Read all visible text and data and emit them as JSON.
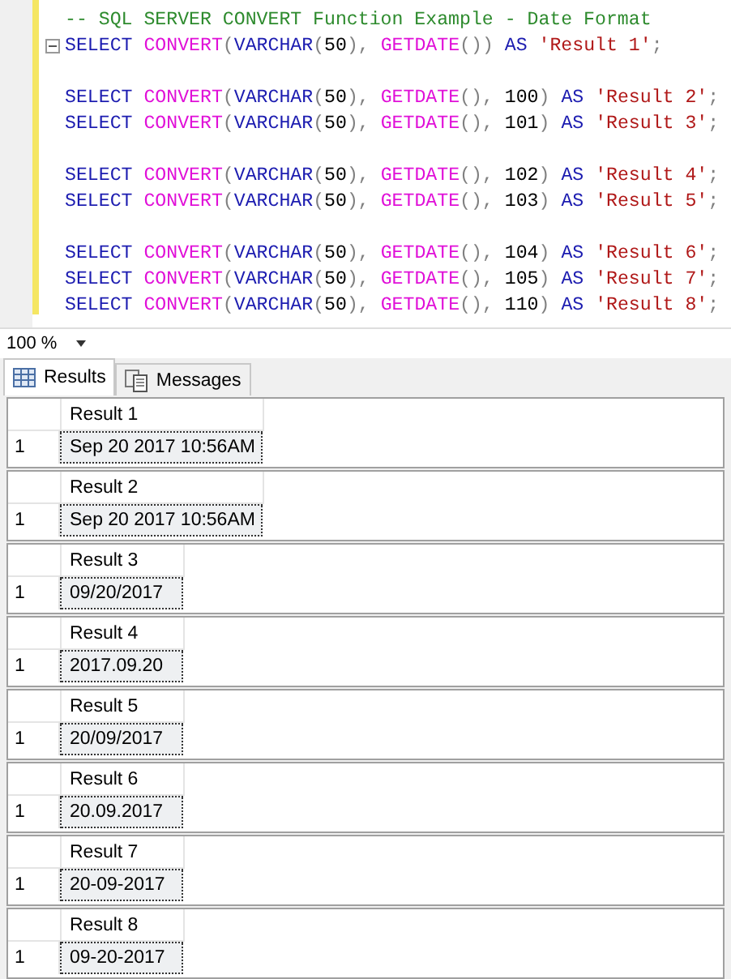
{
  "editor": {
    "blocks": [
      {
        "lines": [
          {
            "fold": false,
            "tokens": [
              {
                "kind": "comment",
                "text": "-- SQL SERVER CONVERT Function Example - Date Format"
              }
            ]
          },
          {
            "fold": true,
            "tokens": [
              {
                "kind": "keyword",
                "text": "SELECT "
              },
              {
                "kind": "function",
                "text": "CONVERT"
              },
              {
                "kind": "punct",
                "text": "("
              },
              {
                "kind": "keyword",
                "text": "VARCHAR"
              },
              {
                "kind": "punct",
                "text": "("
              },
              {
                "kind": "number",
                "text": "50"
              },
              {
                "kind": "punct",
                "text": "), "
              },
              {
                "kind": "function",
                "text": "GETDATE"
              },
              {
                "kind": "punct",
                "text": "()) "
              },
              {
                "kind": "keyword",
                "text": "AS "
              },
              {
                "kind": "string",
                "text": "'Result 1'"
              },
              {
                "kind": "punct",
                "text": ";"
              }
            ]
          }
        ]
      },
      {
        "lines": [
          {
            "fold": false,
            "tokens": [
              {
                "kind": "keyword",
                "text": "SELECT "
              },
              {
                "kind": "function",
                "text": "CONVERT"
              },
              {
                "kind": "punct",
                "text": "("
              },
              {
                "kind": "keyword",
                "text": "VARCHAR"
              },
              {
                "kind": "punct",
                "text": "("
              },
              {
                "kind": "number",
                "text": "50"
              },
              {
                "kind": "punct",
                "text": "), "
              },
              {
                "kind": "function",
                "text": "GETDATE"
              },
              {
                "kind": "punct",
                "text": "(), "
              },
              {
                "kind": "number",
                "text": "100"
              },
              {
                "kind": "punct",
                "text": ") "
              },
              {
                "kind": "keyword",
                "text": "AS "
              },
              {
                "kind": "string",
                "text": "'Result 2'"
              },
              {
                "kind": "punct",
                "text": ";"
              }
            ]
          },
          {
            "fold": false,
            "tokens": [
              {
                "kind": "keyword",
                "text": "SELECT "
              },
              {
                "kind": "function",
                "text": "CONVERT"
              },
              {
                "kind": "punct",
                "text": "("
              },
              {
                "kind": "keyword",
                "text": "VARCHAR"
              },
              {
                "kind": "punct",
                "text": "("
              },
              {
                "kind": "number",
                "text": "50"
              },
              {
                "kind": "punct",
                "text": "), "
              },
              {
                "kind": "function",
                "text": "GETDATE"
              },
              {
                "kind": "punct",
                "text": "(), "
              },
              {
                "kind": "number",
                "text": "101"
              },
              {
                "kind": "punct",
                "text": ") "
              },
              {
                "kind": "keyword",
                "text": "AS "
              },
              {
                "kind": "string",
                "text": "'Result 3'"
              },
              {
                "kind": "punct",
                "text": ";"
              }
            ]
          }
        ]
      },
      {
        "lines": [
          {
            "fold": false,
            "tokens": [
              {
                "kind": "keyword",
                "text": "SELECT "
              },
              {
                "kind": "function",
                "text": "CONVERT"
              },
              {
                "kind": "punct",
                "text": "("
              },
              {
                "kind": "keyword",
                "text": "VARCHAR"
              },
              {
                "kind": "punct",
                "text": "("
              },
              {
                "kind": "number",
                "text": "50"
              },
              {
                "kind": "punct",
                "text": "), "
              },
              {
                "kind": "function",
                "text": "GETDATE"
              },
              {
                "kind": "punct",
                "text": "(), "
              },
              {
                "kind": "number",
                "text": "102"
              },
              {
                "kind": "punct",
                "text": ") "
              },
              {
                "kind": "keyword",
                "text": "AS "
              },
              {
                "kind": "string",
                "text": "'Result 4'"
              },
              {
                "kind": "punct",
                "text": ";"
              }
            ]
          },
          {
            "fold": false,
            "tokens": [
              {
                "kind": "keyword",
                "text": "SELECT "
              },
              {
                "kind": "function",
                "text": "CONVERT"
              },
              {
                "kind": "punct",
                "text": "("
              },
              {
                "kind": "keyword",
                "text": "VARCHAR"
              },
              {
                "kind": "punct",
                "text": "("
              },
              {
                "kind": "number",
                "text": "50"
              },
              {
                "kind": "punct",
                "text": "), "
              },
              {
                "kind": "function",
                "text": "GETDATE"
              },
              {
                "kind": "punct",
                "text": "(), "
              },
              {
                "kind": "number",
                "text": "103"
              },
              {
                "kind": "punct",
                "text": ") "
              },
              {
                "kind": "keyword",
                "text": "AS "
              },
              {
                "kind": "string",
                "text": "'Result 5'"
              },
              {
                "kind": "punct",
                "text": ";"
              }
            ]
          }
        ]
      },
      {
        "lines": [
          {
            "fold": false,
            "tokens": [
              {
                "kind": "keyword",
                "text": "SELECT "
              },
              {
                "kind": "function",
                "text": "CONVERT"
              },
              {
                "kind": "punct",
                "text": "("
              },
              {
                "kind": "keyword",
                "text": "VARCHAR"
              },
              {
                "kind": "punct",
                "text": "("
              },
              {
                "kind": "number",
                "text": "50"
              },
              {
                "kind": "punct",
                "text": "), "
              },
              {
                "kind": "function",
                "text": "GETDATE"
              },
              {
                "kind": "punct",
                "text": "(), "
              },
              {
                "kind": "number",
                "text": "104"
              },
              {
                "kind": "punct",
                "text": ") "
              },
              {
                "kind": "keyword",
                "text": "AS "
              },
              {
                "kind": "string",
                "text": "'Result 6'"
              },
              {
                "kind": "punct",
                "text": ";"
              }
            ]
          },
          {
            "fold": false,
            "tokens": [
              {
                "kind": "keyword",
                "text": "SELECT "
              },
              {
                "kind": "function",
                "text": "CONVERT"
              },
              {
                "kind": "punct",
                "text": "("
              },
              {
                "kind": "keyword",
                "text": "VARCHAR"
              },
              {
                "kind": "punct",
                "text": "("
              },
              {
                "kind": "number",
                "text": "50"
              },
              {
                "kind": "punct",
                "text": "), "
              },
              {
                "kind": "function",
                "text": "GETDATE"
              },
              {
                "kind": "punct",
                "text": "(), "
              },
              {
                "kind": "number",
                "text": "105"
              },
              {
                "kind": "punct",
                "text": ") "
              },
              {
                "kind": "keyword",
                "text": "AS "
              },
              {
                "kind": "string",
                "text": "'Result 7'"
              },
              {
                "kind": "punct",
                "text": ";"
              }
            ]
          },
          {
            "fold": false,
            "tokens": [
              {
                "kind": "keyword",
                "text": "SELECT "
              },
              {
                "kind": "function",
                "text": "CONVERT"
              },
              {
                "kind": "punct",
                "text": "("
              },
              {
                "kind": "keyword",
                "text": "VARCHAR"
              },
              {
                "kind": "punct",
                "text": "("
              },
              {
                "kind": "number",
                "text": "50"
              },
              {
                "kind": "punct",
                "text": "), "
              },
              {
                "kind": "function",
                "text": "GETDATE"
              },
              {
                "kind": "punct",
                "text": "(), "
              },
              {
                "kind": "number",
                "text": "110"
              },
              {
                "kind": "punct",
                "text": ") "
              },
              {
                "kind": "keyword",
                "text": "AS "
              },
              {
                "kind": "string",
                "text": "'Result 8'"
              },
              {
                "kind": "punct",
                "text": ";"
              }
            ]
          }
        ]
      }
    ]
  },
  "zoom": {
    "value": "100 %"
  },
  "tabs": [
    {
      "label": "Results",
      "selected": true,
      "kind": "grid"
    },
    {
      "label": "Messages",
      "selected": false,
      "kind": "messages"
    }
  ],
  "results": [
    {
      "column": "Result 1",
      "row_number": "1",
      "value": "Sep 20 2017 10:56AM"
    },
    {
      "column": "Result 2",
      "row_number": "1",
      "value": "Sep 20 2017 10:56AM"
    },
    {
      "column": "Result 3",
      "row_number": "1",
      "value": "09/20/2017"
    },
    {
      "column": "Result 4",
      "row_number": "1",
      "value": "2017.09.20"
    },
    {
      "column": "Result 5",
      "row_number": "1",
      "value": "20/09/2017"
    },
    {
      "column": "Result 6",
      "row_number": "1",
      "value": "20.09.2017"
    },
    {
      "column": "Result 7",
      "row_number": "1",
      "value": "20-09-2017"
    },
    {
      "column": "Result 8",
      "row_number": "1",
      "value": "09-20-2017"
    }
  ]
}
